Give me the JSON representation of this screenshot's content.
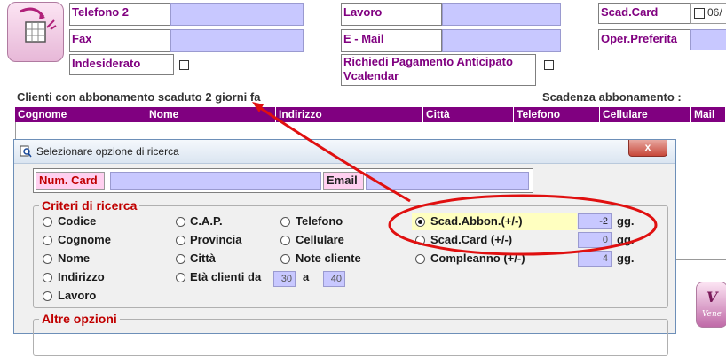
{
  "top_form": {
    "telefono2_label": "Telefono 2",
    "fax_label": "Fax",
    "indesiderato_label": "Indesiderato",
    "lavoro_label": "Lavoro",
    "email_label": "E - Mail",
    "richiedi_label_line1": "Richiedi Pagamento Anticipato",
    "richiedi_label_line2": "Vcalendar",
    "scadcard_label": "Scad.Card",
    "scadcard_value": "06/",
    "oper_label": "Oper.Preferita"
  },
  "section": {
    "expired_caption": "Clienti con abbonamento scaduto 2 giorni fa",
    "scadenza_caption": "Scadenza abbonamento :"
  },
  "table": {
    "columns": [
      "Cognome",
      "Nome",
      "Indirizzo",
      "Città",
      "Telefono",
      "Cellulare",
      "Mail"
    ]
  },
  "dialog": {
    "title": "Selezionare opzione di ricerca",
    "close_glyph": "x",
    "numcard_label": "Num. Card",
    "email_label": "Email",
    "criteria_legend": "Criteri di ricerca",
    "other_legend": "Altre opzioni",
    "col1": [
      "Codice",
      "Cognome",
      "Nome",
      "Indirizzo",
      "Lavoro"
    ],
    "col2": [
      "C.A.P.",
      "Provincia",
      "Città",
      "Età clienti da"
    ],
    "col3": [
      "Telefono",
      "Cellulare",
      "Note cliente"
    ],
    "col4": [
      "Scad.Abbon.(+/-)",
      "Scad.Card (+/-)",
      "Compleanno (+/-)"
    ],
    "age_from": "30",
    "age_to_label": "a",
    "age_to": "40",
    "scad_abbon_value": "-2",
    "scad_card_value": "0",
    "compleanno_value": "4",
    "gg_label": "gg.",
    "selected_option": "Scad.Abbon.(+/-)"
  },
  "colors": {
    "accent": "#800080",
    "field": "#c8c8ff",
    "annotation": "#e01010",
    "highlight": "#ffffc0"
  },
  "icons": [
    "shopping-basket-icon",
    "search-window-icon",
    "close-icon",
    "app-logo-icon"
  ]
}
